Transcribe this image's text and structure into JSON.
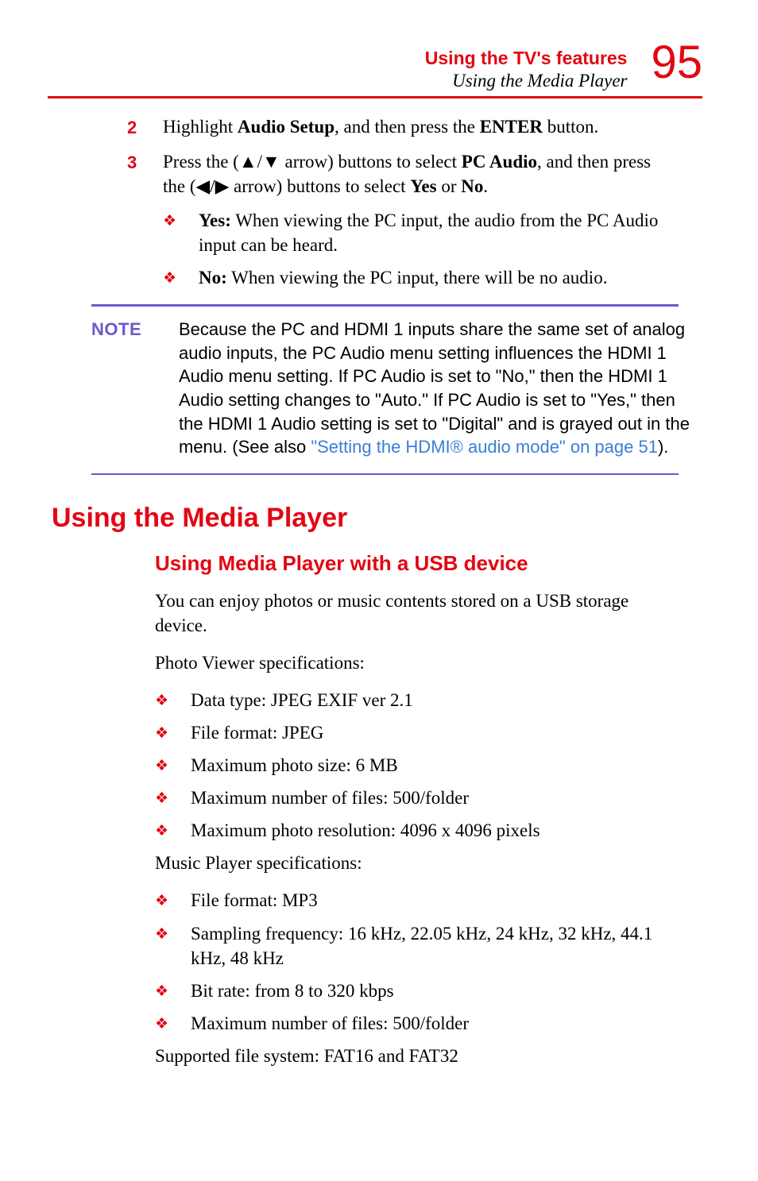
{
  "header": {
    "title": "Using the TV's features",
    "subtitle": "Using the Media Player",
    "page_number": "95"
  },
  "steps": {
    "step2": {
      "num": "2",
      "text_prefix": "Highlight ",
      "bold1": "Audio Setup",
      "text_mid": ", and then press the ",
      "bold2": "ENTER",
      "text_suffix": " button."
    },
    "step3": {
      "num": "3",
      "text_a": "Press the (",
      "text_b": " arrow) buttons to select ",
      "bold1": "PC Audio",
      "text_c": ", and then press the (",
      "text_d": " arrow) buttons to select ",
      "bold2": "Yes",
      "text_e": " or ",
      "bold3": "No",
      "text_f": "."
    }
  },
  "sub": {
    "yes": {
      "label": "Yes:",
      "text": " When viewing the PC input, the audio from the PC Audio input can be heard."
    },
    "no": {
      "label": "No:",
      "text": " When viewing the PC input, there will be no audio."
    }
  },
  "note": {
    "label": "NOTE",
    "body": "Because the PC and HDMI 1 inputs share the same set of analog audio inputs, the PC Audio menu setting influences the HDMI 1 Audio menu setting. If PC Audio is set to \"No,\" then the HDMI 1 Audio setting changes to \"Auto.\" If PC Audio is set to \"Yes,\" then the HDMI 1 Audio setting is set to \"Digital\" and is grayed out in the menu. (See also ",
    "link": "\"Setting the HDMI® audio mode\" on page 51",
    "after": ")."
  },
  "h1": "Using the Media Player",
  "h2": "Using Media Player with a USB device",
  "para1": "You can enjoy photos or music contents stored on a USB storage device.",
  "para2": "Photo Viewer specifications:",
  "photo_specs": [
    "Data type: JPEG EXIF ver 2.1",
    "File format: JPEG",
    "Maximum photo size: 6 MB",
    "Maximum number of files: 500/folder",
    "Maximum photo resolution: 4096 x 4096 pixels"
  ],
  "para3": "Music Player specifications:",
  "music_specs": [
    "File format: MP3",
    "Sampling frequency: 16 kHz, 22.05 kHz, 24 kHz, 32 kHz, 44.1 kHz, 48 kHz",
    "Bit rate: from 8 to 320 kbps",
    "Maximum number of files: 500/folder"
  ],
  "para4": "Supported file system: FAT16 and FAT32"
}
